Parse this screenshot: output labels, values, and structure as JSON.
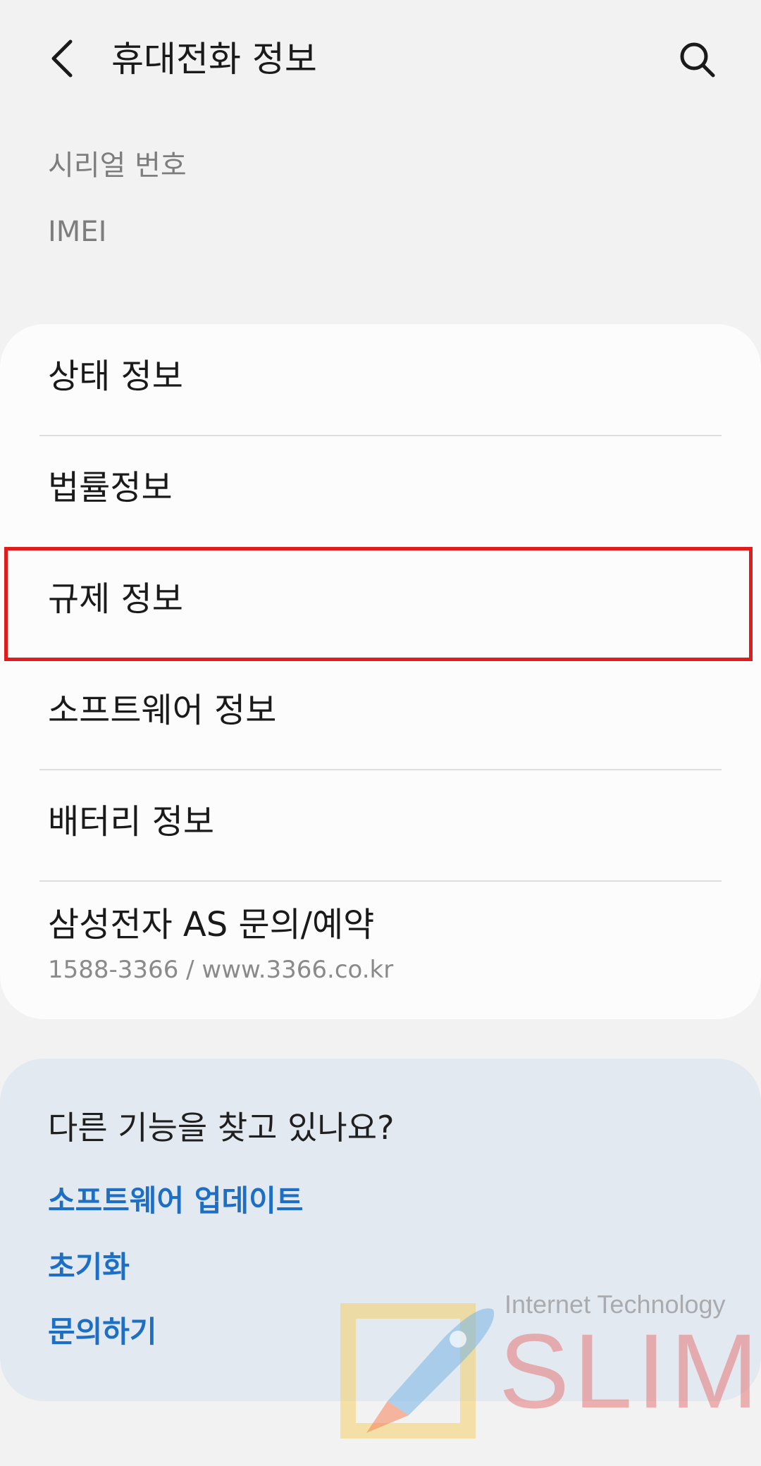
{
  "header": {
    "title": "휴대전화 정보",
    "back_icon": "chevron-left-icon",
    "search_icon": "search-icon"
  },
  "device_info": {
    "serial_label": "시리얼 번호",
    "imei_label": "IMEI"
  },
  "menu": {
    "items": [
      {
        "label": "상태 정보"
      },
      {
        "label": "법률정보"
      },
      {
        "label": "규제 정보",
        "highlighted": true
      },
      {
        "label": "소프트웨어 정보"
      },
      {
        "label": "배터리 정보"
      },
      {
        "label": "삼성전자 AS 문의/예약",
        "sublabel": "1588-3366 / www.3366.co.kr"
      }
    ]
  },
  "related": {
    "title": "다른 기능을 찾고 있나요?",
    "links": [
      "소프트웨어 업데이트",
      "초기화",
      "문의하기"
    ]
  },
  "watermark": {
    "tagline": "Internet Technology",
    "brand": "SLIM"
  },
  "colors": {
    "background": "#f2f2f2",
    "card": "#fcfcfc",
    "related_card": "#e3e9f0",
    "link": "#1c6fc4",
    "highlight": "#e11c1c"
  }
}
